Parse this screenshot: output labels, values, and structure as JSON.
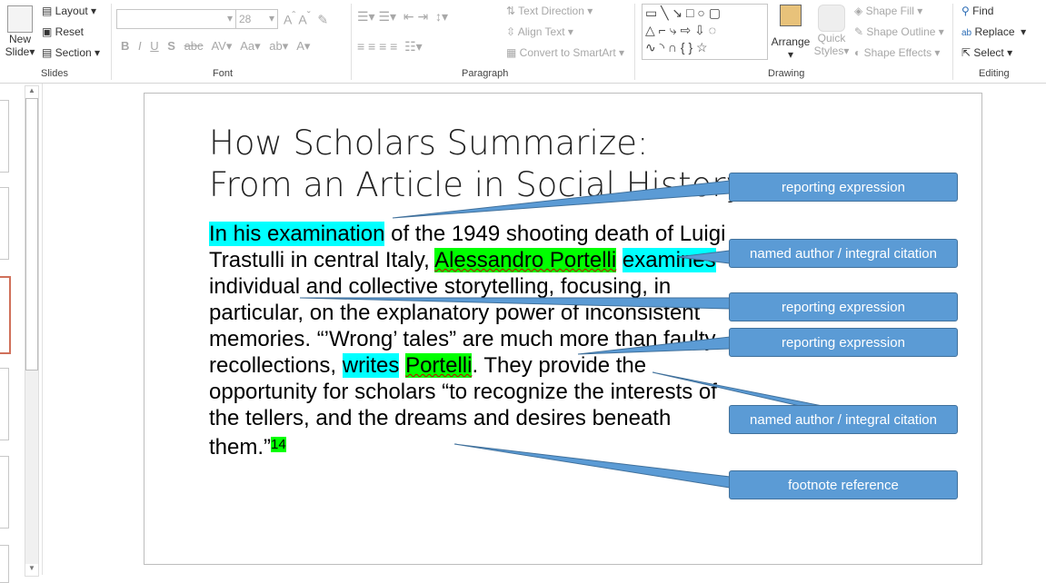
{
  "ribbon": {
    "slides": {
      "new_slide": "New",
      "new_slide2": "Slide",
      "layout": "Layout",
      "reset": "Reset",
      "section": "Section",
      "label": "Slides"
    },
    "font": {
      "font_name": "",
      "font_size": "28",
      "bold": "B",
      "italic": "I",
      "underline": "U",
      "shadow": "S",
      "strike": "abc",
      "spacing": "AV",
      "case": "Aa",
      "color": "A",
      "label": "Font"
    },
    "paragraph": {
      "text_direction": "Text Direction",
      "align_text": "Align Text",
      "smartart": "Convert to SmartArt",
      "label": "Paragraph"
    },
    "drawing": {
      "arrange": "Arrange",
      "quick_styles": "Quick",
      "quick_styles2": "Styles",
      "shape_fill": "Shape Fill",
      "shape_outline": "Shape Outline",
      "shape_effects": "Shape Effects",
      "label": "Drawing"
    },
    "editing": {
      "find": "Find",
      "replace": "Replace",
      "select": "Select",
      "label": "Editing"
    }
  },
  "slide": {
    "title1": "How Scholars Summarize:",
    "title2": "From an Article in Social History",
    "body": {
      "s1": "In his examination",
      "s2": " of the 1949 shooting death of Luigi Trastulli in central Italy, ",
      "s3": "Alessandro Portelli",
      "s4": " ",
      "s5": "examines",
      "s6": " individual and collective storytelling, focusing, in particular, on the explanatory power of inconsistent memories. “’Wrong’ tales” are much more than faulty recollections, ",
      "s7": "writes",
      "s8": " ",
      "s9": "Portelli",
      "s10": ". They provide the opportunity for scholars “to recognize the interests of the tellers, and the dreams and desires beneath them.”",
      "s11": "14"
    },
    "callouts": [
      "reporting expression",
      "named author / integral citation",
      "reporting expression",
      "reporting expression",
      "named author / integral citation",
      "footnote reference"
    ],
    "callout_color": "#5b9bd5"
  }
}
